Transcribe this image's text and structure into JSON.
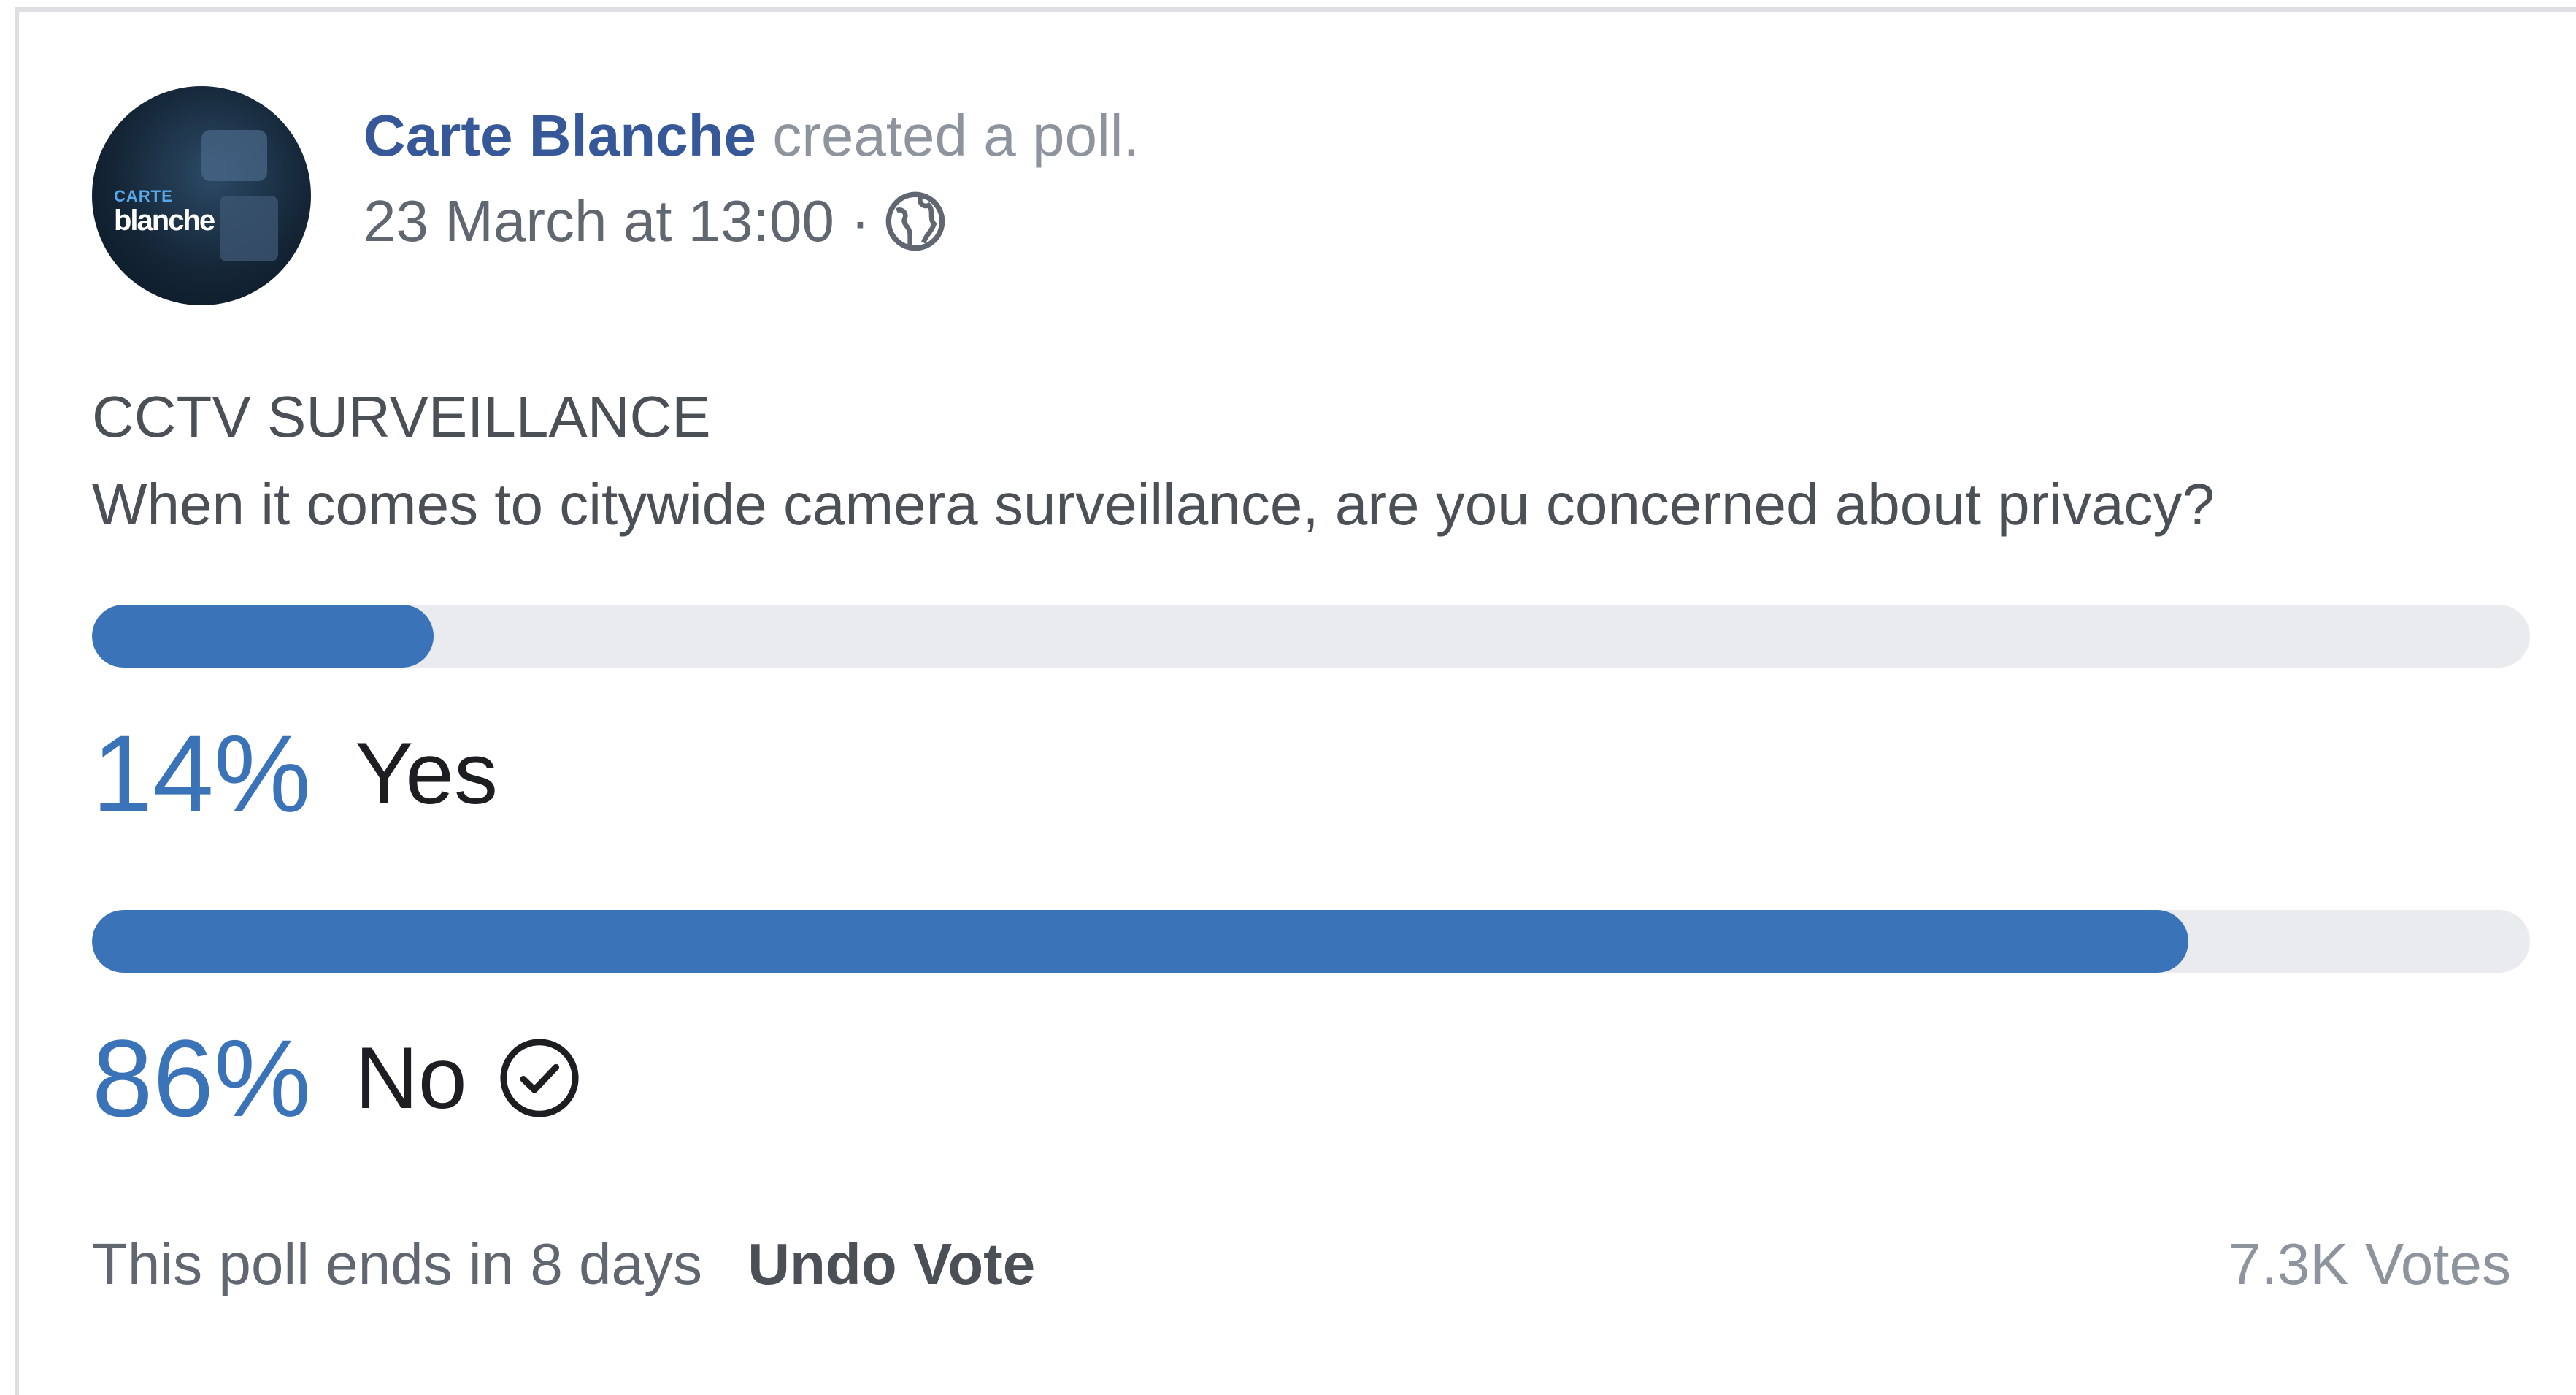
{
  "post": {
    "author": "Carte Blanche",
    "action": "created a poll.",
    "timestamp": "23 March at 13:00 ·",
    "privacy_icon": "globe-icon",
    "avatar_text_top": "CARTE",
    "avatar_text_bottom": "blanche"
  },
  "poll": {
    "title": "CCTV SURVEILLANCE",
    "question": "When it comes to citywide camera surveillance, are you concerned about privacy?",
    "options": [
      {
        "percent_label": "14%",
        "label": "Yes",
        "fill_fraction": 0.14,
        "selected": false
      },
      {
        "percent_label": "86%",
        "label": "No",
        "fill_fraction": 0.86,
        "selected": true
      }
    ],
    "ends_text": "This poll ends in 8 days",
    "undo_label": "Undo Vote",
    "votes_text": "7.3K Votes"
  },
  "colors": {
    "accent": "#3b73b9",
    "author_link": "#365899",
    "track": "#e9ebee"
  }
}
